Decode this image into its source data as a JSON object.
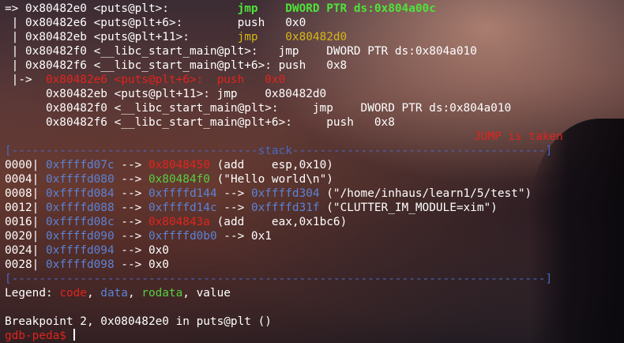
{
  "code": {
    "lines": [
      {
        "prefix": "=> ",
        "addr": "0x80482e0",
        "sym": " <puts@plt>:          ",
        "op": "jmp",
        "pad": "    ",
        "arg": "DWORD PTR ds:0x804a00c"
      },
      {
        "prefix": " | ",
        "addr": "0x80482e6",
        "sym": " <puts@plt+6>:        ",
        "op": "push",
        "pad": "   ",
        "arg": "0x0"
      },
      {
        "prefix": " | ",
        "addr": "0x80482eb",
        "sym": " <puts@plt+11>:       ",
        "op": "jmp",
        "pad": "    ",
        "arg": "0x80482d0"
      },
      {
        "prefix": " | ",
        "addr": "0x80482f0",
        "sym": " <__libc_start_main@plt>:   ",
        "op": "jmp",
        "pad": "    ",
        "arg": "DWORD PTR ds:0x804a010"
      },
      {
        "prefix": " | ",
        "addr": "0x80482f6",
        "sym": " <__libc_start_main@plt+6>: ",
        "op": "push",
        "pad": "   ",
        "arg": "0x8"
      },
      {
        "prefix": " |->  ",
        "addr": "0x80482e6",
        "sym": " <puts@plt+6>:  ",
        "op": "push",
        "pad": "   ",
        "arg": "0x0"
      },
      {
        "prefix": "      ",
        "addr": "0x80482eb",
        "sym": " <puts@plt+11>: ",
        "op": "jmp",
        "pad": "    ",
        "arg": "0x80482d0"
      },
      {
        "prefix": "      ",
        "addr": "0x80482f0",
        "sym": " <__libc_start_main@plt>:     ",
        "op": "jmp",
        "pad": "    ",
        "arg": "DWORD PTR ds:0x804a010"
      },
      {
        "prefix": "      ",
        "addr": "0x80482f6",
        "sym": " <__libc_start_main@plt+6>:     ",
        "op": "push",
        "pad": "   ",
        "arg": "0x8"
      }
    ],
    "status": "JUMP is taken"
  },
  "stack": {
    "top_divider": "[------------------------------------stack-------------------------------------]",
    "bottom_divider": "[------------------------------------------------------------------------------]",
    "rows": [
      {
        "off": "0000|",
        "addr": "0xffffd07c",
        "a1": " --> ",
        "v1": "0x8048450",
        "rest": " (add    esp,0x10)"
      },
      {
        "off": "0004|",
        "addr": "0xffffd080",
        "a1": " --> ",
        "v1": "0x80484f0",
        "rest": " (\"Hello world\\n\")"
      },
      {
        "off": "0008|",
        "addr": "0xffffd084",
        "a1": " --> ",
        "v1": "0xffffd144",
        "a2": " --> ",
        "v2": "0xffffd304",
        "rest": " (\"/home/inhaus/learn1/5/test\")"
      },
      {
        "off": "0012|",
        "addr": "0xffffd088",
        "a1": " --> ",
        "v1": "0xffffd14c",
        "a2": " --> ",
        "v2": "0xffffd31f",
        "rest": " (\"CLUTTER_IM_MODULE=xim\")"
      },
      {
        "off": "0016|",
        "addr": "0xffffd08c",
        "a1": " --> ",
        "v1": "0x804843a",
        "rest": " (add    eax,0x1bc6)"
      },
      {
        "off": "0020|",
        "addr": "0xffffd090",
        "a1": " --> ",
        "v1": "0xffffd0b0",
        "rest": " --> 0x1"
      },
      {
        "off": "0024|",
        "addr": "0xffffd094",
        "a1": " --> ",
        "v1": "0x0",
        "rest": ""
      },
      {
        "off": "0028|",
        "addr": "0xffffd098",
        "a1": " --> ",
        "v1": "0x0",
        "rest": ""
      }
    ]
  },
  "legend": {
    "label": "Legend: ",
    "code": "code",
    "sep1": ", ",
    "data": "data",
    "sep2": ", ",
    "rodata": "rodata",
    "sep3": ", ",
    "value": "value"
  },
  "breakpoint": "Breakpoint 2, 0x080482e0 in puts@plt ()",
  "prompt": "gdb-peda$ ",
  "colors": {
    "code": "#e0241e",
    "data": "#5b83d6",
    "rodata": "#55d040",
    "value": "#ffffff",
    "current": "#4fe33a",
    "divider": "#4a68c0"
  }
}
